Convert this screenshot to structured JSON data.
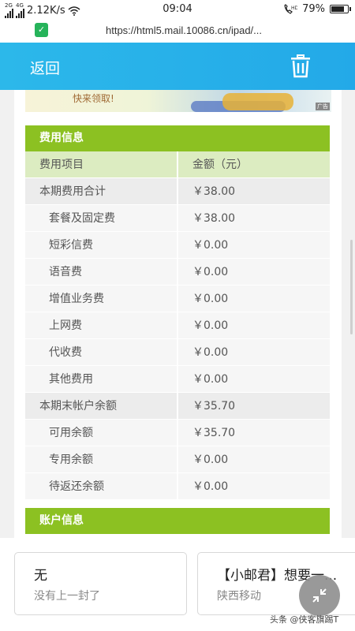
{
  "status_bar": {
    "net1": "2G",
    "net2": "4G",
    "speed": "2.12K/s",
    "time": "09:04",
    "battery": "79%",
    "battery_level": 0.79
  },
  "browser": {
    "url": "https://html5.mail.10086.cn/ipad/..."
  },
  "app_bar": {
    "back_label": "返回",
    "delete_icon": "trash-icon"
  },
  "ad": {
    "text": "快来领取!",
    "badge": "广告"
  },
  "fee_section": {
    "title": "费用信息",
    "columns": [
      "费用项目",
      "金额（元）"
    ],
    "rows": [
      {
        "item": "本期费用合计",
        "amount": "￥38.00",
        "level": "total"
      },
      {
        "item": "套餐及固定费",
        "amount": "￥38.00",
        "level": "sub"
      },
      {
        "item": "短彩信费",
        "amount": "￥0.00",
        "level": "sub"
      },
      {
        "item": "语音费",
        "amount": "￥0.00",
        "level": "sub"
      },
      {
        "item": "增值业务费",
        "amount": "￥0.00",
        "level": "sub"
      },
      {
        "item": "上网费",
        "amount": "￥0.00",
        "level": "sub"
      },
      {
        "item": "代收费",
        "amount": "￥0.00",
        "level": "sub"
      },
      {
        "item": "其他费用",
        "amount": "￥0.00",
        "level": "sub"
      },
      {
        "item": "本期末帐户余额",
        "amount": "￥35.70",
        "level": "total"
      },
      {
        "item": "可用余额",
        "amount": "￥35.70",
        "level": "sub"
      },
      {
        "item": "专用余额",
        "amount": "￥0.00",
        "level": "sub"
      },
      {
        "item": "待返还余额",
        "amount": "￥0.00",
        "level": "sub"
      }
    ]
  },
  "account_section": {
    "title": "账户信息"
  },
  "nav": {
    "prev": {
      "title": "无",
      "subtitle": "没有上一封了"
    },
    "next": {
      "title": "【小邮君】想要一...",
      "subtitle": "陕西移动"
    }
  },
  "fab_icon": "collapse-arrows-icon",
  "watermark": "头条 @侠客旗踢T"
}
